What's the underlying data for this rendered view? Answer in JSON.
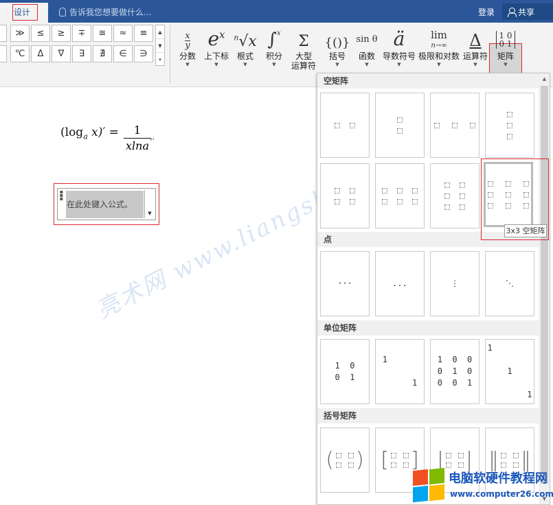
{
  "topbar": {
    "tab_design": "设计",
    "tell_me": "告诉我您想要做什么...",
    "login": "登录",
    "share": "共享"
  },
  "symbols": {
    "row1": [
      "≫",
      "≤",
      "≥",
      "∓",
      "≅",
      "≈",
      "≡"
    ],
    "row2": [
      "℃",
      "Δ",
      "∇",
      "∃",
      "∄",
      "∈",
      "∋"
    ]
  },
  "ribbon": {
    "buttons": [
      {
        "label": "分数",
        "icon": "x/y"
      },
      {
        "label": "上下标",
        "icon": "eˣ"
      },
      {
        "label": "根式",
        "icon": "ⁿ√x"
      },
      {
        "label": "积分",
        "icon": "∫"
      },
      {
        "label": "大型\n运算符",
        "icon": "Σ"
      },
      {
        "label": "括号",
        "icon": "{()}"
      },
      {
        "label": "函数",
        "icon": "sin θ"
      },
      {
        "label": "导数符号",
        "icon": "ä"
      },
      {
        "label": "极限和对数",
        "icon": "lim"
      },
      {
        "label": "运算符",
        "icon": "Δ"
      },
      {
        "label": "矩阵",
        "icon": "[10 01]"
      }
    ]
  },
  "document": {
    "formula_left": "(log",
    "formula_sub": "a",
    "formula_right": " x)′ =",
    "frac_num": "1",
    "frac_den": "xlna",
    "placeholder": "在此处键入公式。"
  },
  "panel": {
    "sections": [
      "空矩阵",
      "点",
      "单位矩阵",
      "括号矩阵"
    ],
    "dots": [
      "···",
      "...",
      "⋮",
      "⋱"
    ],
    "identity": [
      "1  0\n0  1",
      "1\n\n      1",
      "1  0  0\n0  1  0\n0  0  1",
      "1\n\n    1\n\n        1"
    ],
    "tooltip": "3x3 空矩阵"
  },
  "watermark": {
    "text": "亮术网 www.liangshunet.com",
    "logo_title": "电脑软硬件教程网",
    "logo_url": "www.computer26.com",
    "colors": {
      "red": "#f25022",
      "green": "#7fba00",
      "blue": "#00a4ef",
      "yellow": "#ffb900"
    }
  }
}
